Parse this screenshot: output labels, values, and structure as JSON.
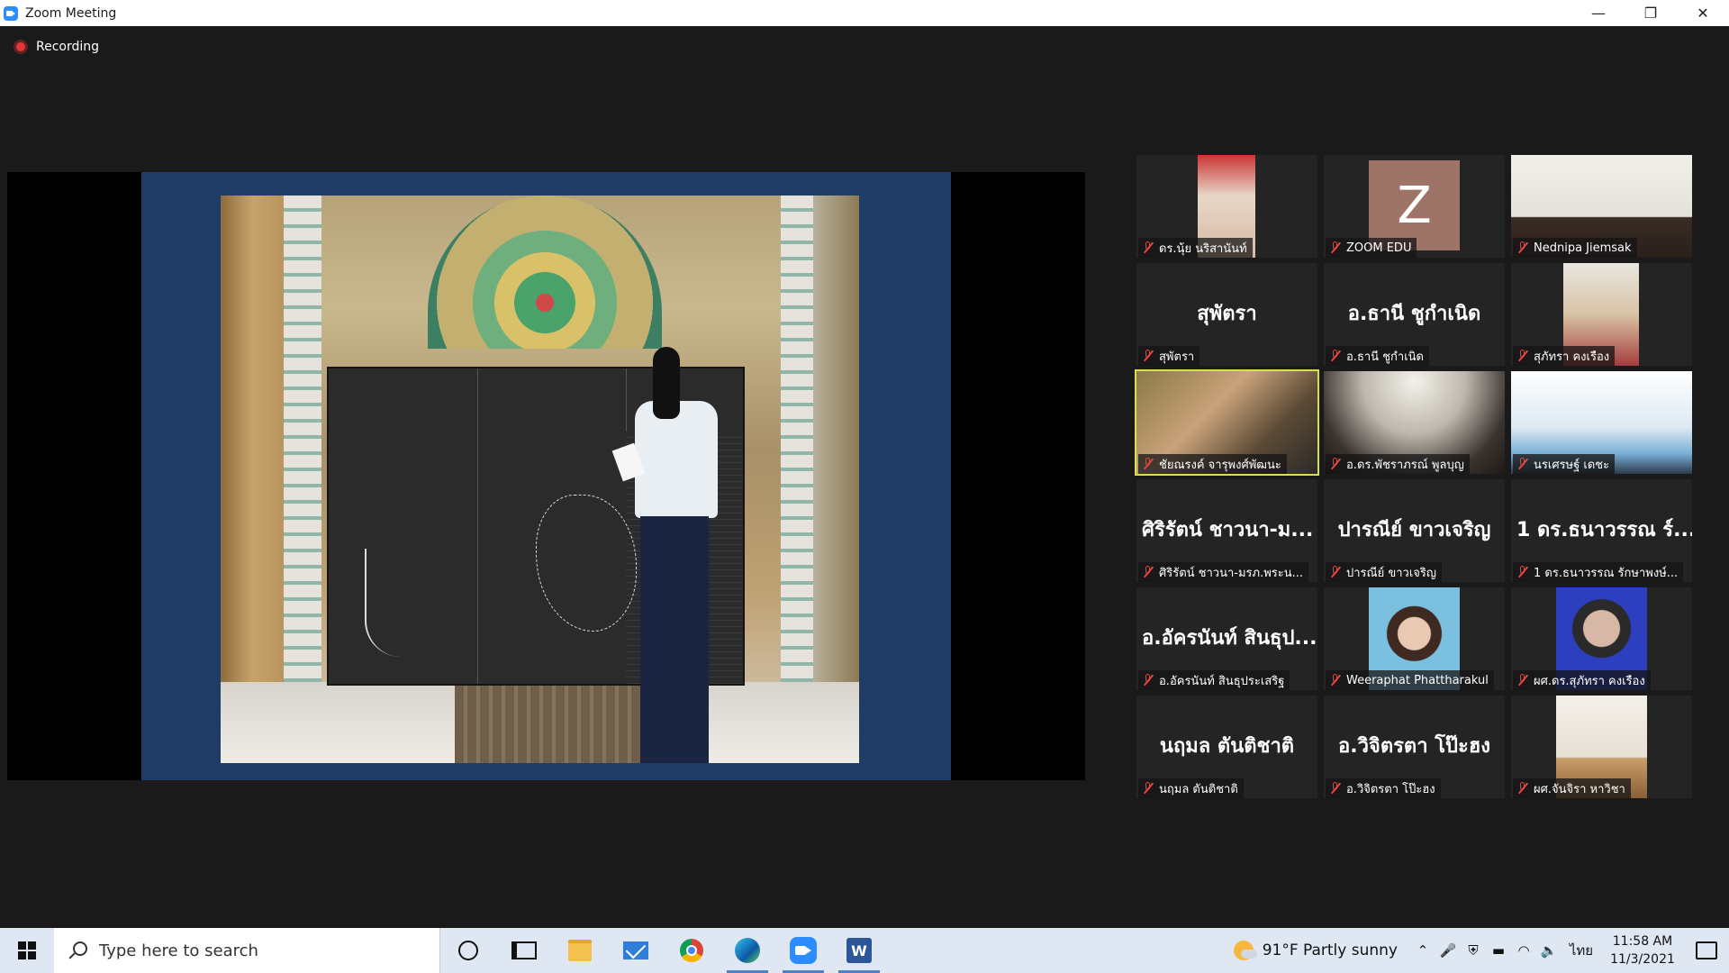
{
  "window": {
    "title": "Zoom Meeting",
    "controls": {
      "minimize": "—",
      "restore": "❐",
      "close": "✕"
    }
  },
  "recording": {
    "label": "Recording"
  },
  "gallery": {
    "participants": [
      {
        "label": "ดร.นุ้ย นริสานันท์",
        "big": "",
        "video": true,
        "active": false
      },
      {
        "label": "ZOOM EDU",
        "big": "",
        "avatar_letter": "Z",
        "video": false,
        "active": false
      },
      {
        "label": "Nednipa Jiemsak",
        "big": "",
        "video": true,
        "active": false
      },
      {
        "label": "สุพัตรา",
        "big": "สุพัตรา",
        "video": false,
        "active": false
      },
      {
        "label": "อ.ธานี  ชูกำเนิด",
        "big": "อ.ธานี  ชูกำเนิด",
        "video": false,
        "active": false
      },
      {
        "label": "สุภัทรา คงเรือง",
        "big": "",
        "video": true,
        "active": false
      },
      {
        "label": "ชัยณรงค์ จารุพงศ์พัฒนะ",
        "big": "",
        "video": true,
        "active": true
      },
      {
        "label": "อ.ดร.พัชราภรณ์ พูลบุญ",
        "big": "",
        "video": true,
        "active": false
      },
      {
        "label": "นรเศรษฐ์ เดชะ",
        "big": "",
        "video": true,
        "active": false
      },
      {
        "label": "ศิริรัตน์ ชาวนา-มรภ.พระน...",
        "big": "ศิริรัตน์ ชาวนา-ม...",
        "video": false,
        "active": false
      },
      {
        "label": "ปารณีย์ ขาวเจริญ",
        "big": "ปารณีย์ ขาวเจริญ",
        "video": false,
        "active": false
      },
      {
        "label": "1 ดร.ธนาวรรณ รักษาพงษ์...",
        "big": "1 ดร.ธนาวรรณ ร์...",
        "video": false,
        "active": false
      },
      {
        "label": "อ.อัครนันท์ สินธุประเสริฐ",
        "big": "อ.อัครนันท์ สินธุป...",
        "video": false,
        "active": false
      },
      {
        "label": "Weeraphat Phattharakul",
        "big": "",
        "video": true,
        "active": false
      },
      {
        "label": "ผศ.ดร.สุภัทรา คงเรือง",
        "big": "",
        "video": true,
        "active": false
      },
      {
        "label": "นฤมล ตันติชาติ",
        "big": "นฤมล ตันติชาติ",
        "video": false,
        "active": false
      },
      {
        "label": "อ.วิจิตรตา  โป๊ะฮง",
        "big": "อ.วิจิตรตา  โป๊ะฮง",
        "video": false,
        "active": false
      },
      {
        "label": "ผศ.จันจิรา หาวิชา",
        "big": "",
        "video": true,
        "active": false
      }
    ]
  },
  "taskbar": {
    "search_placeholder": "Type here to search",
    "weather": "91°F  Partly sunny",
    "language": "ไทย",
    "time": "11:58 AM",
    "date": "11/3/2021",
    "word_letter": "W"
  },
  "colors": {
    "background": "#1a1a1a",
    "active_speaker": "#d8e14d",
    "mic_muted": "#e3463f",
    "zoom_blue": "#2d8cff"
  }
}
